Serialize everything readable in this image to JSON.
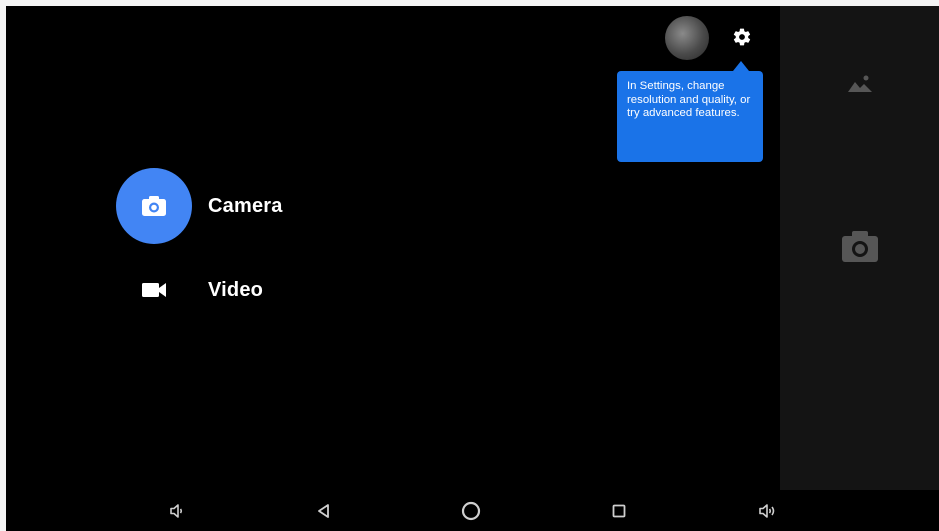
{
  "modes": {
    "camera": {
      "label": "Camera",
      "icon": "camera-icon",
      "active": true
    },
    "video": {
      "label": "Video",
      "icon": "videocam-icon",
      "active": false
    }
  },
  "tooltip": {
    "text": "In Settings, change resolution and quality, or try advanced features."
  },
  "top_controls": {
    "thumbnail": "gallery-thumbnail",
    "settings_icon": "gear-icon"
  },
  "side_panel": {
    "icons": [
      "photo-icon",
      "camera-shutter-icon"
    ]
  },
  "navbar": {
    "buttons": [
      "volume-down-icon",
      "back-icon",
      "home-icon",
      "recents-icon",
      "volume-up-icon"
    ]
  },
  "colors": {
    "accent": "#4285f4",
    "tooltip_bg": "#1a73e8",
    "background": "#000000",
    "side_panel": "#141414"
  }
}
